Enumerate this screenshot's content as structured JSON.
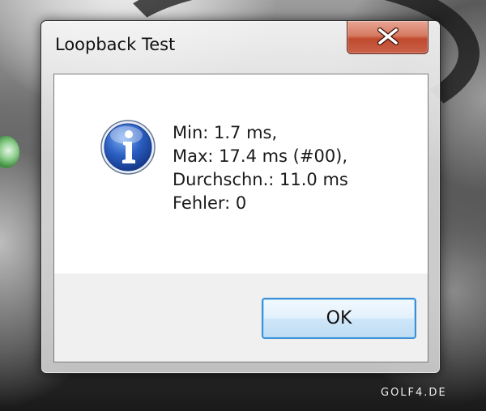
{
  "window": {
    "title": "Loopback Test",
    "close_icon": "close-icon"
  },
  "message": {
    "icon": "info-icon",
    "lines": [
      "Min: 1.7 ms,",
      "Max: 17.4 ms (#00),",
      "Durchschn.: 11.0 ms",
      "Fehler: 0"
    ]
  },
  "buttons": {
    "ok_label": "OK"
  },
  "desktop": {
    "watermark": "GOLF4.DE"
  },
  "colors": {
    "close_button": "#c9533a",
    "ok_border": "#3c8fd6",
    "info_icon_blue": "#1f4fb4"
  }
}
